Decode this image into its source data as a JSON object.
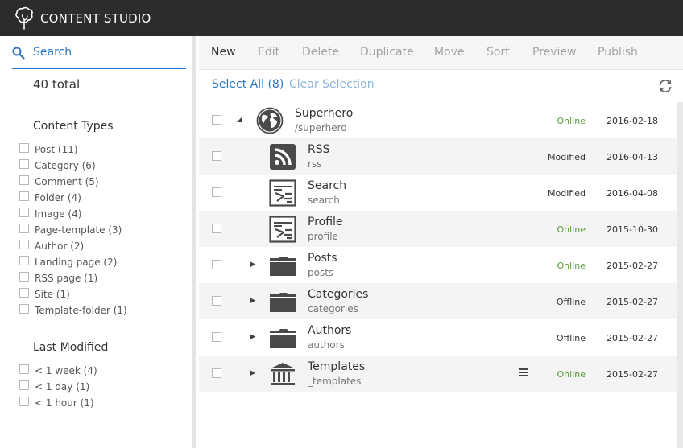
{
  "app": {
    "title": "CONTENT STUDIO",
    "logo_icon": "tree-logo-icon"
  },
  "search": {
    "label": "Search",
    "icon": "search-icon"
  },
  "filter": {
    "total": "40 total",
    "content_types": {
      "title": "Content Types",
      "items": [
        {
          "label": "Post (11)"
        },
        {
          "label": "Category (6)"
        },
        {
          "label": "Comment (5)"
        },
        {
          "label": "Folder (4)"
        },
        {
          "label": "Image (4)"
        },
        {
          "label": "Page-template (3)"
        },
        {
          "label": "Author (2)"
        },
        {
          "label": "Landing page (2)"
        },
        {
          "label": "RSS page (1)"
        },
        {
          "label": "Site (1)"
        },
        {
          "label": "Template-folder (1)"
        }
      ]
    },
    "last_modified": {
      "title": "Last Modified",
      "items": [
        {
          "label": "< 1 week (4)"
        },
        {
          "label": "< 1 day (1)"
        },
        {
          "label": "< 1 hour (1)"
        }
      ]
    }
  },
  "toolbar": {
    "new": "New",
    "edit": "Edit",
    "delete": "Delete",
    "duplicate": "Duplicate",
    "move": "Move",
    "sort": "Sort",
    "preview": "Preview",
    "publish": "Publish"
  },
  "selection": {
    "select_all": "Select All (8)",
    "clear_selection": "Clear Selection",
    "refresh_icon": "refresh-icon"
  },
  "colors": {
    "accent": "#2c76c1",
    "online": "#5b9b3d",
    "topbar": "#2c2c2c",
    "icon": "#4a4a4a"
  },
  "rows": [
    {
      "name": "Superhero",
      "path": "/superhero",
      "status": "Online",
      "date": "2016-02-18",
      "icon": "globe-icon",
      "expander": "expanded"
    },
    {
      "name": "RSS",
      "path": "rss",
      "status": "Modified",
      "date": "2016-04-13",
      "icon": "rss-icon",
      "expander": "none"
    },
    {
      "name": "Search",
      "path": "search",
      "status": "Modified",
      "date": "2016-04-08",
      "icon": "page-template-icon",
      "expander": "none"
    },
    {
      "name": "Profile",
      "path": "profile",
      "status": "Online",
      "date": "2015-10-30",
      "icon": "page-template-icon",
      "expander": "none"
    },
    {
      "name": "Posts",
      "path": "posts",
      "status": "Online",
      "date": "2015-02-27",
      "icon": "folder-icon",
      "expander": "collapsed"
    },
    {
      "name": "Categories",
      "path": "categories",
      "status": "Offline",
      "date": "2015-02-27",
      "icon": "folder-icon",
      "expander": "collapsed"
    },
    {
      "name": "Authors",
      "path": "authors",
      "status": "Offline",
      "date": "2015-02-27",
      "icon": "folder-icon",
      "expander": "collapsed"
    },
    {
      "name": "Templates",
      "path": "_templates",
      "status": "Online",
      "date": "2015-02-27",
      "icon": "templates-icon",
      "expander": "collapsed",
      "has_menu": true
    }
  ]
}
